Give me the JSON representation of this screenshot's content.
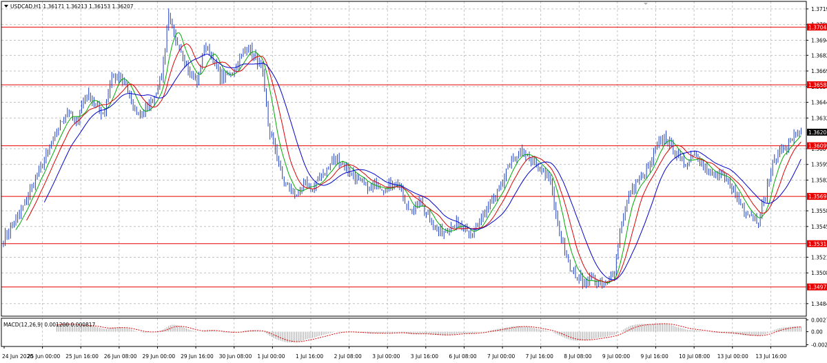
{
  "chart_data": {
    "type": "line",
    "title": "USDCAD,H1  1.36171 1.36213 1.36153 1.36207",
    "symbol": "USDCAD,H1",
    "ohlc": {
      "open": "1.36171",
      "high": "1.36213",
      "low": "1.36153",
      "close": "1.36207"
    },
    "price_axis": {
      "ylim": [
        1.3474,
        1.3725
      ],
      "ticks": [
        "1.37190",
        "1.37065",
        "1.36940",
        "1.36820",
        "1.36695",
        "1.36570",
        "1.36445",
        "1.36320",
        "1.36075",
        "1.35950",
        "1.35825",
        "1.35580",
        "1.35455",
        "1.35210",
        "1.35085",
        "1.34840"
      ]
    },
    "time_axis": {
      "labels": [
        "24 Jun 2020",
        "25 Jun 00:00",
        "25 Jun 16:00",
        "26 Jun 08:00",
        "29 Jun 00:00",
        "29 Jun 16:00",
        "30 Jun 08:00",
        "1 Jul 00:00",
        "1 Jul 16:00",
        "2 Jul 08:00",
        "3 Jul 00:00",
        "3 Jul 16:00",
        "6 Jul 08:00",
        "7 Jul 00:00",
        "7 Jul 16:00",
        "8 Jul 08:00",
        "9 Jul 00:00",
        "9 Jul 16:00",
        "10 Jul 08:00",
        "13 Jul 00:00",
        "13 Jul 16:00"
      ]
    },
    "current_price": {
      "label": "1.36207",
      "value": 1.36207
    },
    "levels": [
      {
        "label": "1.37045",
        "value": 1.37045
      },
      {
        "label": "1.36585",
        "value": 1.36585
      },
      {
        "label": "1.36099",
        "value": 1.36099
      },
      {
        "label": "1.35695",
        "value": 1.35695
      },
      {
        "label": "1.35318",
        "value": 1.35318
      },
      {
        "label": "1.34973",
        "value": 1.34973
      }
    ],
    "price_path": [
      [
        0,
        1.3536
      ],
      [
        2,
        1.3552
      ],
      [
        4,
        1.3578
      ],
      [
        6,
        1.3602
      ],
      [
        8,
        1.3628
      ],
      [
        9,
        1.364
      ],
      [
        10,
        1.3625
      ],
      [
        11,
        1.3645
      ],
      [
        12,
        1.365
      ],
      [
        13,
        1.364
      ],
      [
        14,
        1.3635
      ],
      [
        15,
        1.3665
      ],
      [
        17,
        1.366
      ],
      [
        18,
        1.364
      ],
      [
        19,
        1.3635
      ],
      [
        20,
        1.364
      ],
      [
        21,
        1.365
      ],
      [
        22,
        1.3665
      ],
      [
        23,
        1.3715
      ],
      [
        24,
        1.369
      ],
      [
        25,
        1.368
      ],
      [
        26,
        1.367
      ],
      [
        27,
        1.366
      ],
      [
        28,
        1.369
      ],
      [
        29,
        1.3682
      ],
      [
        30,
        1.3665
      ],
      [
        31,
        1.3665
      ],
      [
        32,
        1.367
      ],
      [
        33,
        1.368
      ],
      [
        34,
        1.369
      ],
      [
        35,
        1.368
      ],
      [
        36,
        1.367
      ],
      [
        36.5,
        1.3645
      ],
      [
        37,
        1.362
      ],
      [
        38,
        1.3605
      ],
      [
        39,
        1.358
      ],
      [
        40,
        1.3575
      ],
      [
        41,
        1.357
      ],
      [
        42,
        1.358
      ],
      [
        43,
        1.3575
      ],
      [
        44,
        1.3585
      ],
      [
        45,
        1.359
      ],
      [
        46,
        1.36
      ],
      [
        47,
        1.3597
      ],
      [
        48,
        1.359
      ],
      [
        49,
        1.3585
      ],
      [
        50,
        1.358
      ],
      [
        51,
        1.3575
      ],
      [
        52,
        1.358
      ],
      [
        53,
        1.3575
      ],
      [
        54,
        1.358
      ],
      [
        55,
        1.358
      ],
      [
        56,
        1.356
      ],
      [
        57,
        1.356
      ],
      [
        58,
        1.3565
      ],
      [
        59,
        1.3555
      ],
      [
        60,
        1.3545
      ],
      [
        61,
        1.354
      ],
      [
        62,
        1.3545
      ],
      [
        63,
        1.3548
      ],
      [
        64,
        1.3542
      ],
      [
        65,
        1.3538
      ],
      [
        66,
        1.3548
      ],
      [
        67,
        1.3555
      ],
      [
        68,
        1.3565
      ],
      [
        69,
        1.3575
      ],
      [
        70,
        1.359
      ],
      [
        71,
        1.36
      ],
      [
        72,
        1.3605
      ],
      [
        73,
        1.36
      ],
      [
        74,
        1.3595
      ],
      [
        75,
        1.359
      ],
      [
        76,
        1.3585
      ],
      [
        77,
        1.355
      ],
      [
        78,
        1.353
      ],
      [
        79,
        1.351
      ],
      [
        80,
        1.3505
      ],
      [
        81,
        1.35
      ],
      [
        82,
        1.3505
      ],
      [
        83,
        1.3498
      ],
      [
        84,
        1.35
      ],
      [
        85,
        1.351
      ],
      [
        86,
        1.355
      ],
      [
        87,
        1.357
      ],
      [
        88,
        1.358
      ],
      [
        89,
        1.3585
      ],
      [
        90,
        1.3595
      ],
      [
        91,
        1.361
      ],
      [
        92,
        1.3618
      ],
      [
        93,
        1.3608
      ],
      [
        94,
        1.36
      ],
      [
        95,
        1.3595
      ],
      [
        96,
        1.3605
      ],
      [
        97,
        1.3598
      ],
      [
        98,
        1.359
      ],
      [
        99,
        1.3585
      ],
      [
        100,
        1.3585
      ],
      [
        101,
        1.358
      ],
      [
        102,
        1.357
      ],
      [
        103,
        1.356
      ],
      [
        104,
        1.3555
      ],
      [
        105,
        1.355
      ],
      [
        106,
        1.357
      ],
      [
        107,
        1.3595
      ],
      [
        108,
        1.3605
      ],
      [
        109,
        1.361
      ],
      [
        110,
        1.3618
      ],
      [
        111,
        1.3621
      ]
    ],
    "moving_averages": [
      {
        "color": "#00aa00",
        "period": 8
      },
      {
        "color": "#dd0000",
        "period": 14
      },
      {
        "color": "#0000cc",
        "period": 24
      }
    ],
    "macd": {
      "label": "MACD(12,26,9) 0.001200 0.000817",
      "name": "MACD(12,26,9)",
      "value": "0.001200",
      "signal_value": "0.000817",
      "ticks": [
        "0.002736",
        "0.00",
        "-0.00299"
      ],
      "ylim": [
        -0.0034,
        0.0031
      ],
      "fast": 12,
      "slow": 26,
      "signal": 9
    },
    "colors": {
      "background": "#ffffff",
      "grid": "#b8b8b8",
      "price": "#2040c0",
      "level": "#e80000",
      "current_tag": "#000000",
      "macd_hist": "#a8a8a8",
      "macd_signal": "#e00000"
    },
    "grid": true
  }
}
